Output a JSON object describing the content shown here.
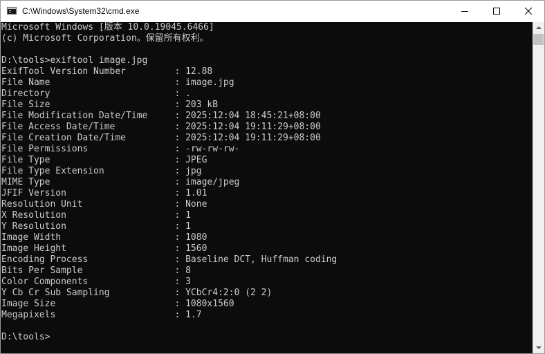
{
  "window": {
    "title": "C:\\Windows\\System32\\cmd.exe",
    "icon": "cmd-icon",
    "controls": {
      "minimize_icon": "minimize-icon",
      "maximize_icon": "maximize-icon",
      "close_icon": "close-icon"
    }
  },
  "colors": {
    "console_background": "#0c0c0c",
    "console_text": "#cccccc",
    "titlebar_background": "#ffffff",
    "scrollbar_track": "#f0f0f0",
    "scrollbar_thumb": "#c2c2c2"
  },
  "console": {
    "lines": [
      "Microsoft Windows [版本 10.0.19045.6466]",
      "(c) Microsoft Corporation。保留所有权利。",
      "",
      "D:\\tools>exiftool image.jpg",
      "ExifTool Version Number         : 12.88",
      "File Name                       : image.jpg",
      "Directory                       : .",
      "File Size                       : 203 kB",
      "File Modification Date/Time     : 2025:12:04 18:45:21+08:00",
      "File Access Date/Time           : 2025:12:04 19:11:29+08:00",
      "File Creation Date/Time         : 2025:12:04 19:11:29+08:00",
      "File Permissions                : -rw-rw-rw-",
      "File Type                       : JPEG",
      "File Type Extension             : jpg",
      "MIME Type                       : image/jpeg",
      "JFIF Version                    : 1.01",
      "Resolution Unit                 : None",
      "X Resolution                    : 1",
      "Y Resolution                    : 1",
      "Image Width                     : 1080",
      "Image Height                    : 1560",
      "Encoding Process                : Baseline DCT, Huffman coding",
      "Bits Per Sample                 : 8",
      "Color Components                : 3",
      "Y Cb Cr Sub Sampling            : YCbCr4:2:0 (2 2)",
      "Image Size                      : 1080x1560",
      "Megapixels                      : 1.7",
      "",
      "D:\\tools>"
    ]
  }
}
